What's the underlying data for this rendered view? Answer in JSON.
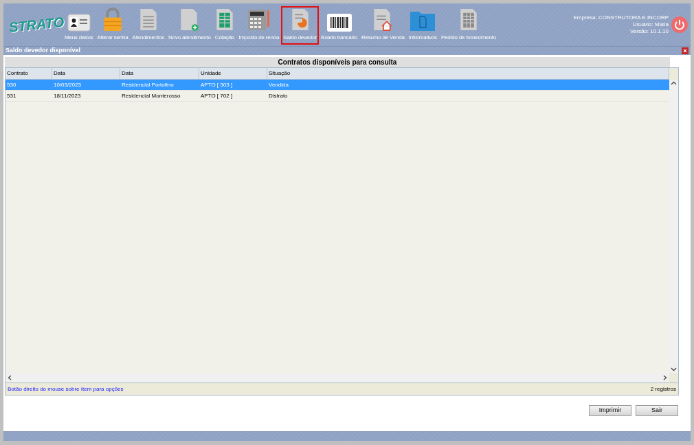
{
  "logo": "STRATO",
  "toolbar": [
    {
      "label": "Meus dados",
      "selected": false
    },
    {
      "label": "Alterar senha",
      "selected": false
    },
    {
      "label": "Atendimentos",
      "selected": false
    },
    {
      "label": "Novo atendimento",
      "selected": false
    },
    {
      "label": "Cotação",
      "selected": false
    },
    {
      "label": "Imposto de renda",
      "selected": false
    },
    {
      "label": "Saldo devedor",
      "selected": true
    },
    {
      "label": "Boleto bancário",
      "selected": false
    },
    {
      "label": "Resumo de Venda",
      "selected": false
    },
    {
      "label": "Informativos",
      "selected": false
    },
    {
      "label": "Pedido de fornecimento",
      "selected": false
    }
  ],
  "session": [
    "Empresa: CONSTRUTORA E INCORP",
    "Usuário: Maria",
    "Versão: 10.1.10"
  ],
  "window": {
    "title": "Saldo devedor disponível"
  },
  "table": {
    "title": "Contratos disponíveis para consulta",
    "columns": [
      "Contrato",
      "Data",
      "Data",
      "Unidade",
      "Situação"
    ],
    "rows": [
      {
        "cells": [
          "530",
          "10/03/2023",
          "Residencial Portofino",
          "APTO [ 303 ]",
          "Vendida"
        ],
        "selected": true
      },
      {
        "cells": [
          "531",
          "18/11/2023",
          "Residencial Monterosso",
          "APTO [ 702 ]",
          "Distrato"
        ],
        "selected": false
      }
    ],
    "hint": "Botão direito do mouse sobre ítem para opções",
    "count": "2 registros"
  },
  "buttons": [
    "Imprimir",
    "Sair"
  ]
}
